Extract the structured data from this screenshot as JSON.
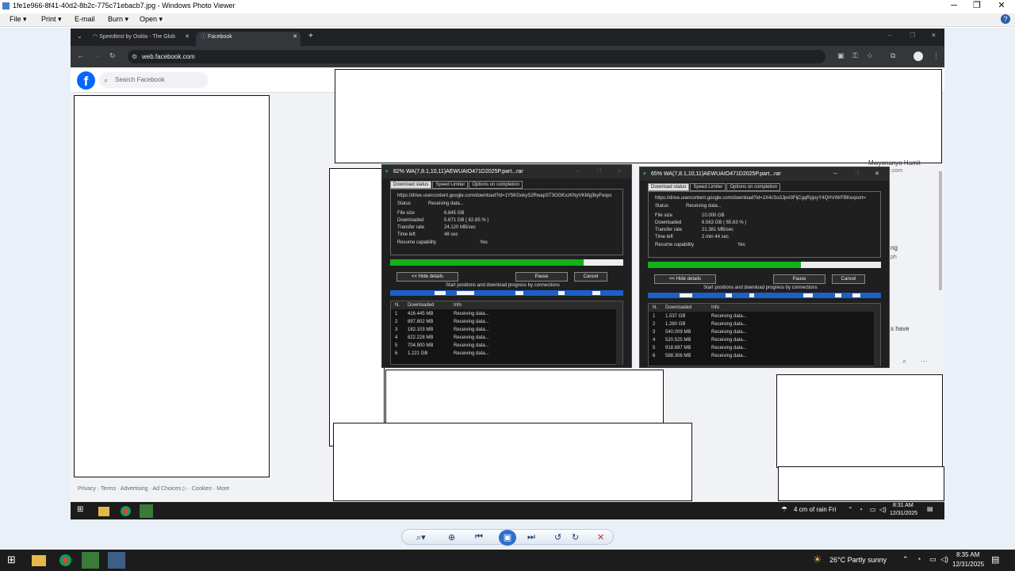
{
  "viewer": {
    "title": "1fe1e966-8f41-40d2-8b2c-775c71ebacb7.jpg - Windows Photo Viewer",
    "menu": [
      "File ▾",
      "Print ▾",
      "E-mail",
      "Burn ▾",
      "Open ▾"
    ]
  },
  "browser": {
    "tabs": [
      {
        "label": "Speedtest by Ookla - The Glob"
      },
      {
        "label": "Facebook"
      }
    ],
    "url": "web.facebook.com"
  },
  "facebook": {
    "search_placeholder": "Search Facebook",
    "footer": "Privacy · Terms · Advertising · Ad Choices ▷ · Cookies · More",
    "side_text": [
      "Mwyonanyo Hamit",
      "r.com",
      "ng",
      "ph",
      "s have"
    ]
  },
  "idm": [
    {
      "title": "82% WA(7,8.1,10,11)AEWUAIO471D2025P.part...rar",
      "tabs": [
        "Download status",
        "Speed Limiter",
        "Options on completion"
      ],
      "url": "https://drive.usercontent.google.com/download?id=1Y5KGokyS2RwapST3OGKxzKNyVKMg3kyFexpc",
      "status_label": "Status",
      "status": "Receiving data...",
      "rows": [
        [
          "File size",
          "6.845  GB"
        ],
        [
          "Downloaded",
          "5.671  GB  ( 82.85 % )"
        ],
        [
          "Transfer rate",
          "24.120  MB/sec"
        ],
        [
          "Time left",
          "48 sec"
        ],
        [
          "Resume capability",
          "Yes"
        ]
      ],
      "progress": 0.8285,
      "hide_label": "<< Hide details",
      "pause_label": "Pause",
      "cancel_label": "Cancel",
      "conn_label": "Start positions and download progress by connections",
      "table_headers": [
        "N.",
        "Downloaded",
        "Info"
      ],
      "table": [
        [
          "1",
          "416.445  MB",
          "Receiving data..."
        ],
        [
          "2",
          "897.802  MB",
          "Receiving data..."
        ],
        [
          "3",
          "182.103  MB",
          "Receiving data..."
        ],
        [
          "4",
          "822.228  MB",
          "Receiving data..."
        ],
        [
          "5",
          "704.900  MB",
          "Receiving data..."
        ],
        [
          "6",
          "1.221  GB",
          "Receiving data..."
        ]
      ]
    },
    {
      "title": "65% WA(7,8.1,10,11)AEWUAIO471D2025P.part...rar",
      "tabs": [
        "Download status",
        "Speed Limiter",
        "Options on completion"
      ],
      "url": "https://drive.usercontent.google.com/download?id=1X4cSo3Jpvl3FljCgqRpjxyY4QHVWrFBKexport=",
      "status_label": "Status",
      "status": "Receiving data...",
      "rows": [
        [
          "File size",
          "10.000  GB"
        ],
        [
          "Downloaded",
          "6.563  GB  ( 65.63 % )"
        ],
        [
          "Transfer rate",
          "21.381  MB/sec"
        ],
        [
          "Time left",
          "2 min 44 sec"
        ],
        [
          "Resume capability",
          "Yes"
        ]
      ],
      "progress": 0.6563,
      "hide_label": "<< Hide details",
      "pause_label": "Pause",
      "cancel_label": "Cancel",
      "conn_label": "Start positions and download progress by connections",
      "table_headers": [
        "N.",
        "Downloaded",
        "Info"
      ],
      "table": [
        [
          "1",
          "1.537  GB",
          "Receiving data..."
        ],
        [
          "2",
          "1.260  GB",
          "Receiving data..."
        ],
        [
          "3",
          "540.009  MB",
          "Receiving data..."
        ],
        [
          "4",
          "520.525  MB",
          "Receiving data..."
        ],
        [
          "5",
          "918.697  MB",
          "Receiving data..."
        ],
        [
          "6",
          "588.306  MB",
          "Receiving data..."
        ]
      ]
    }
  ],
  "inner_taskbar": {
    "weather": "4 cm of rain Fri",
    "time": "8:31 AM",
    "date": "12/31/2025"
  },
  "taskbar": {
    "weather": "26°C  Partly sunny",
    "time": "8:35 AM",
    "date": "12/31/2025"
  }
}
